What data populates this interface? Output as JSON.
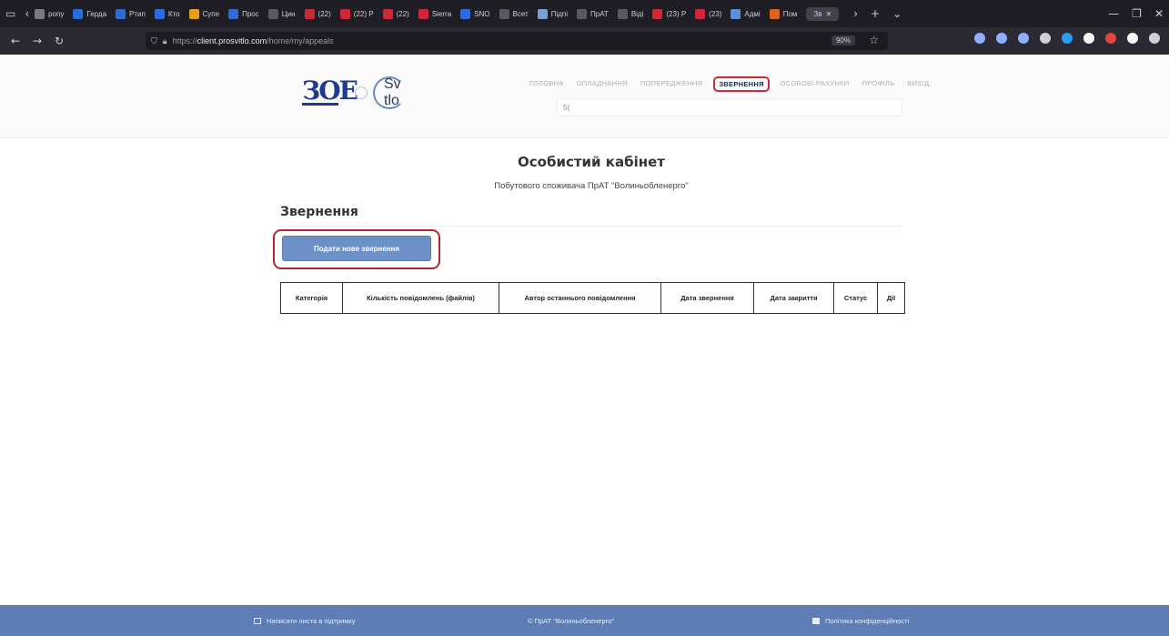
{
  "browser": {
    "tabs": [
      {
        "label": "ропу",
        "color": "#7a7a82"
      },
      {
        "label": "Герда",
        "color": "#2b6cd6"
      },
      {
        "label": "Ртип",
        "color": "#2b6cd6"
      },
      {
        "label": "Кто",
        "color": "#2b6cd6"
      },
      {
        "label": "Супе",
        "color": "#e0a020"
      },
      {
        "label": "Прос",
        "color": "#2b6cd6"
      },
      {
        "label": "Цин",
        "color": "#555a66"
      },
      {
        "label": "(22)",
        "color": "#d0263a"
      },
      {
        "label": "(22) Р",
        "color": "#d0263a"
      },
      {
        "label": "(22)",
        "color": "#d0263a"
      },
      {
        "label": "Sierra",
        "color": "#d0263a"
      },
      {
        "label": "SNO",
        "color": "#2b6cd6"
      },
      {
        "label": "Всет",
        "color": "#555a66"
      },
      {
        "label": "Підпі",
        "color": "#7a9fd6"
      },
      {
        "label": "ПрАТ",
        "color": "#555a66"
      },
      {
        "label": "Віді",
        "color": "#555a66"
      },
      {
        "label": "(23) Р",
        "color": "#d0263a"
      },
      {
        "label": "(23)",
        "color": "#d0263a"
      },
      {
        "label": "Адмі",
        "color": "#5a8fe0"
      },
      {
        "label": "Пом",
        "color": "#e06020"
      }
    ],
    "active_tab": "Зв",
    "url_prefix": "https://",
    "url_host": "client.prosvitlo.com",
    "url_path": "/home/my/appeals",
    "zoom": "90%",
    "ext_colors": [
      "#8fb0ff",
      "#8fb0ff",
      "#8fb0ff",
      "#cfcfd6",
      "#2d9bf0",
      "#f5f5f5",
      "#e0463e",
      "#f5f5f5",
      "#cfcfd6"
    ]
  },
  "header": {
    "logo_main": "ЗОЕ",
    "logo_secondary": "Sv tlo",
    "menu": [
      {
        "label": "ГОЛОВНА",
        "active": false
      },
      {
        "label": "ОПЛАДНАННЯ",
        "active": false
      },
      {
        "label": "ПОПЕРЕДЖЕННЯ",
        "active": false
      },
      {
        "label": "ЗВЕРНЕННЯ",
        "active": true
      },
      {
        "label": "ОСОБОВІ РАХУНКИ",
        "active": false
      },
      {
        "label": "ПРОФІЛЬ",
        "active": false
      },
      {
        "label": "ВИХІД",
        "active": false
      }
    ],
    "search_value": "5("
  },
  "page": {
    "title": "Особистий кабінет",
    "subtitle": "Побутового споживача ПрАТ \"Волиньобленерго\"",
    "section_title": "Звернення",
    "new_appeal_button": "Подати нове звернення",
    "table_headers": [
      "Категорія",
      "Кількість повідомлень (файлів)",
      "Автор останнього повідомлення",
      "Дата звернення",
      "Дата закриття",
      "Статус",
      "Дії"
    ]
  },
  "footer": {
    "support": "Написати листа в підтримку",
    "copyright": "© ПрАТ \"Волиньобленерго\"",
    "privacy": "Політика конфіденційності"
  }
}
